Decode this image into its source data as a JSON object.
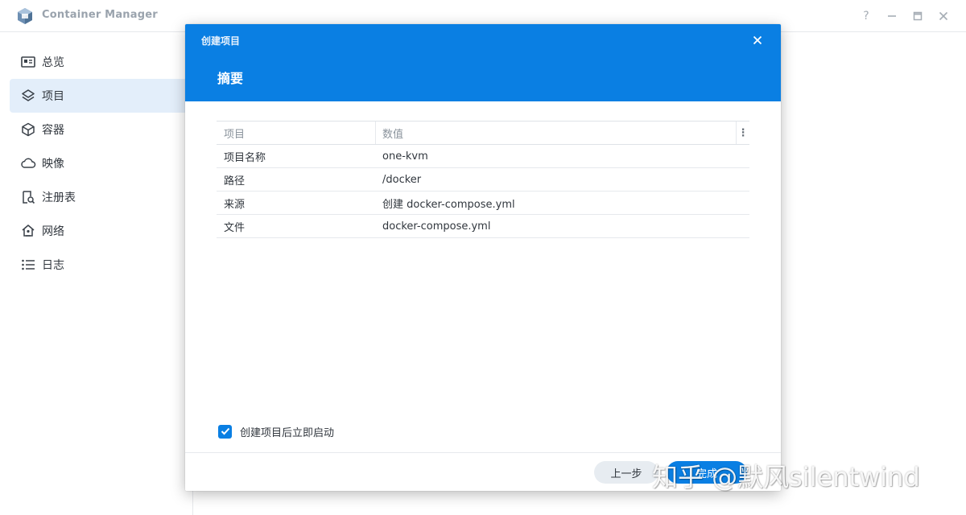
{
  "app": {
    "title": "Container Manager"
  },
  "window_controls": {
    "help": "?",
    "minimize": "—",
    "maximize": "□",
    "close": "✕"
  },
  "sidebar": {
    "items": [
      {
        "label": "总览",
        "icon": "overview-icon"
      },
      {
        "label": "项目",
        "icon": "layers-icon",
        "active": true
      },
      {
        "label": "容器",
        "icon": "cube-icon"
      },
      {
        "label": "映像",
        "icon": "cloud-icon"
      },
      {
        "label": "注册表",
        "icon": "registry-search-icon"
      },
      {
        "label": "网络",
        "icon": "network-home-icon"
      },
      {
        "label": "日志",
        "icon": "list-icon"
      }
    ]
  },
  "dialog": {
    "window_title": "创建项目",
    "heading": "摘要",
    "table": {
      "headers": [
        "项目",
        "数值"
      ],
      "rows": [
        {
          "key": "项目名称",
          "value": "one-kvm"
        },
        {
          "key": "路径",
          "value": "/docker"
        },
        {
          "key": "来源",
          "value": "创建 docker-compose.yml"
        },
        {
          "key": "文件",
          "value": "docker-compose.yml"
        }
      ]
    },
    "checkbox": {
      "label": "创建项目后立即启动",
      "checked": true
    },
    "buttons": {
      "back": "上一步",
      "finish": "完成"
    }
  },
  "watermark": "知乎 @默风silentwind",
  "colors": {
    "accent": "#0a7fe3",
    "sidebar_active": "#e3eefa"
  }
}
